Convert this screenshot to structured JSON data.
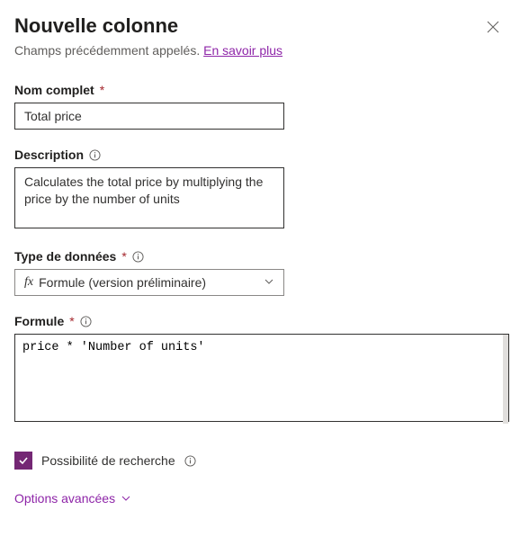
{
  "header": {
    "title": "Nouvelle colonne",
    "subtitle_prefix": "Champs précédemment appelés. ",
    "subtitle_link": "En savoir plus"
  },
  "fields": {
    "display_name": {
      "label": "Nom complet",
      "value": "Total price"
    },
    "description": {
      "label": "Description",
      "value": "Calculates the total price by multiplying the price by the number of units"
    },
    "data_type": {
      "label": "Type de données",
      "prefix": "fx",
      "value": "Formule (version préliminaire)"
    },
    "formula": {
      "label": "Formule",
      "value": "price * 'Number of units'"
    }
  },
  "searchable": {
    "label": "Possibilité de recherche",
    "checked": true
  },
  "advanced": {
    "label": "Options avancées"
  }
}
